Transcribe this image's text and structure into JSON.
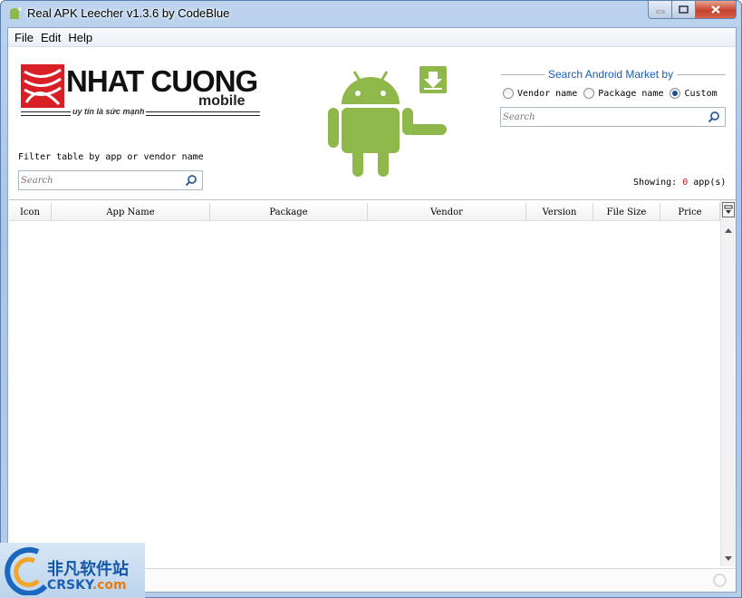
{
  "window": {
    "title": "Real APK Leecher v1.3.6 by CodeBlue"
  },
  "menu": [
    {
      "label": "File"
    },
    {
      "label": "Edit"
    },
    {
      "label": "Help"
    }
  ],
  "logo": {
    "name": "NHAT CUONG",
    "sub": "mobile",
    "tagline": "uy tín là sức mạnh"
  },
  "market_search": {
    "title": "Search Android Market by",
    "options": [
      {
        "label": "Vendor name",
        "checked": false
      },
      {
        "label": "Package name",
        "checked": false
      },
      {
        "label": "Custom",
        "checked": true
      }
    ],
    "placeholder": "Search"
  },
  "filter": {
    "label": "Filter table by app or vendor name",
    "placeholder": "Search"
  },
  "showing": {
    "prefix": "Showing:",
    "count": "0",
    "suffix": "app(s)"
  },
  "table": {
    "columns": [
      "Icon",
      "App Name",
      "Package",
      "Vendor",
      "Version",
      "File Size",
      "Price"
    ],
    "rows": []
  },
  "watermark": {
    "cn": "非凡软件站",
    "en_a": "CRSKY",
    "en_b": ".com"
  },
  "colors": {
    "accent": "#1b5db7",
    "android_green": "#8fb84a",
    "count_red": "#dd1122"
  }
}
